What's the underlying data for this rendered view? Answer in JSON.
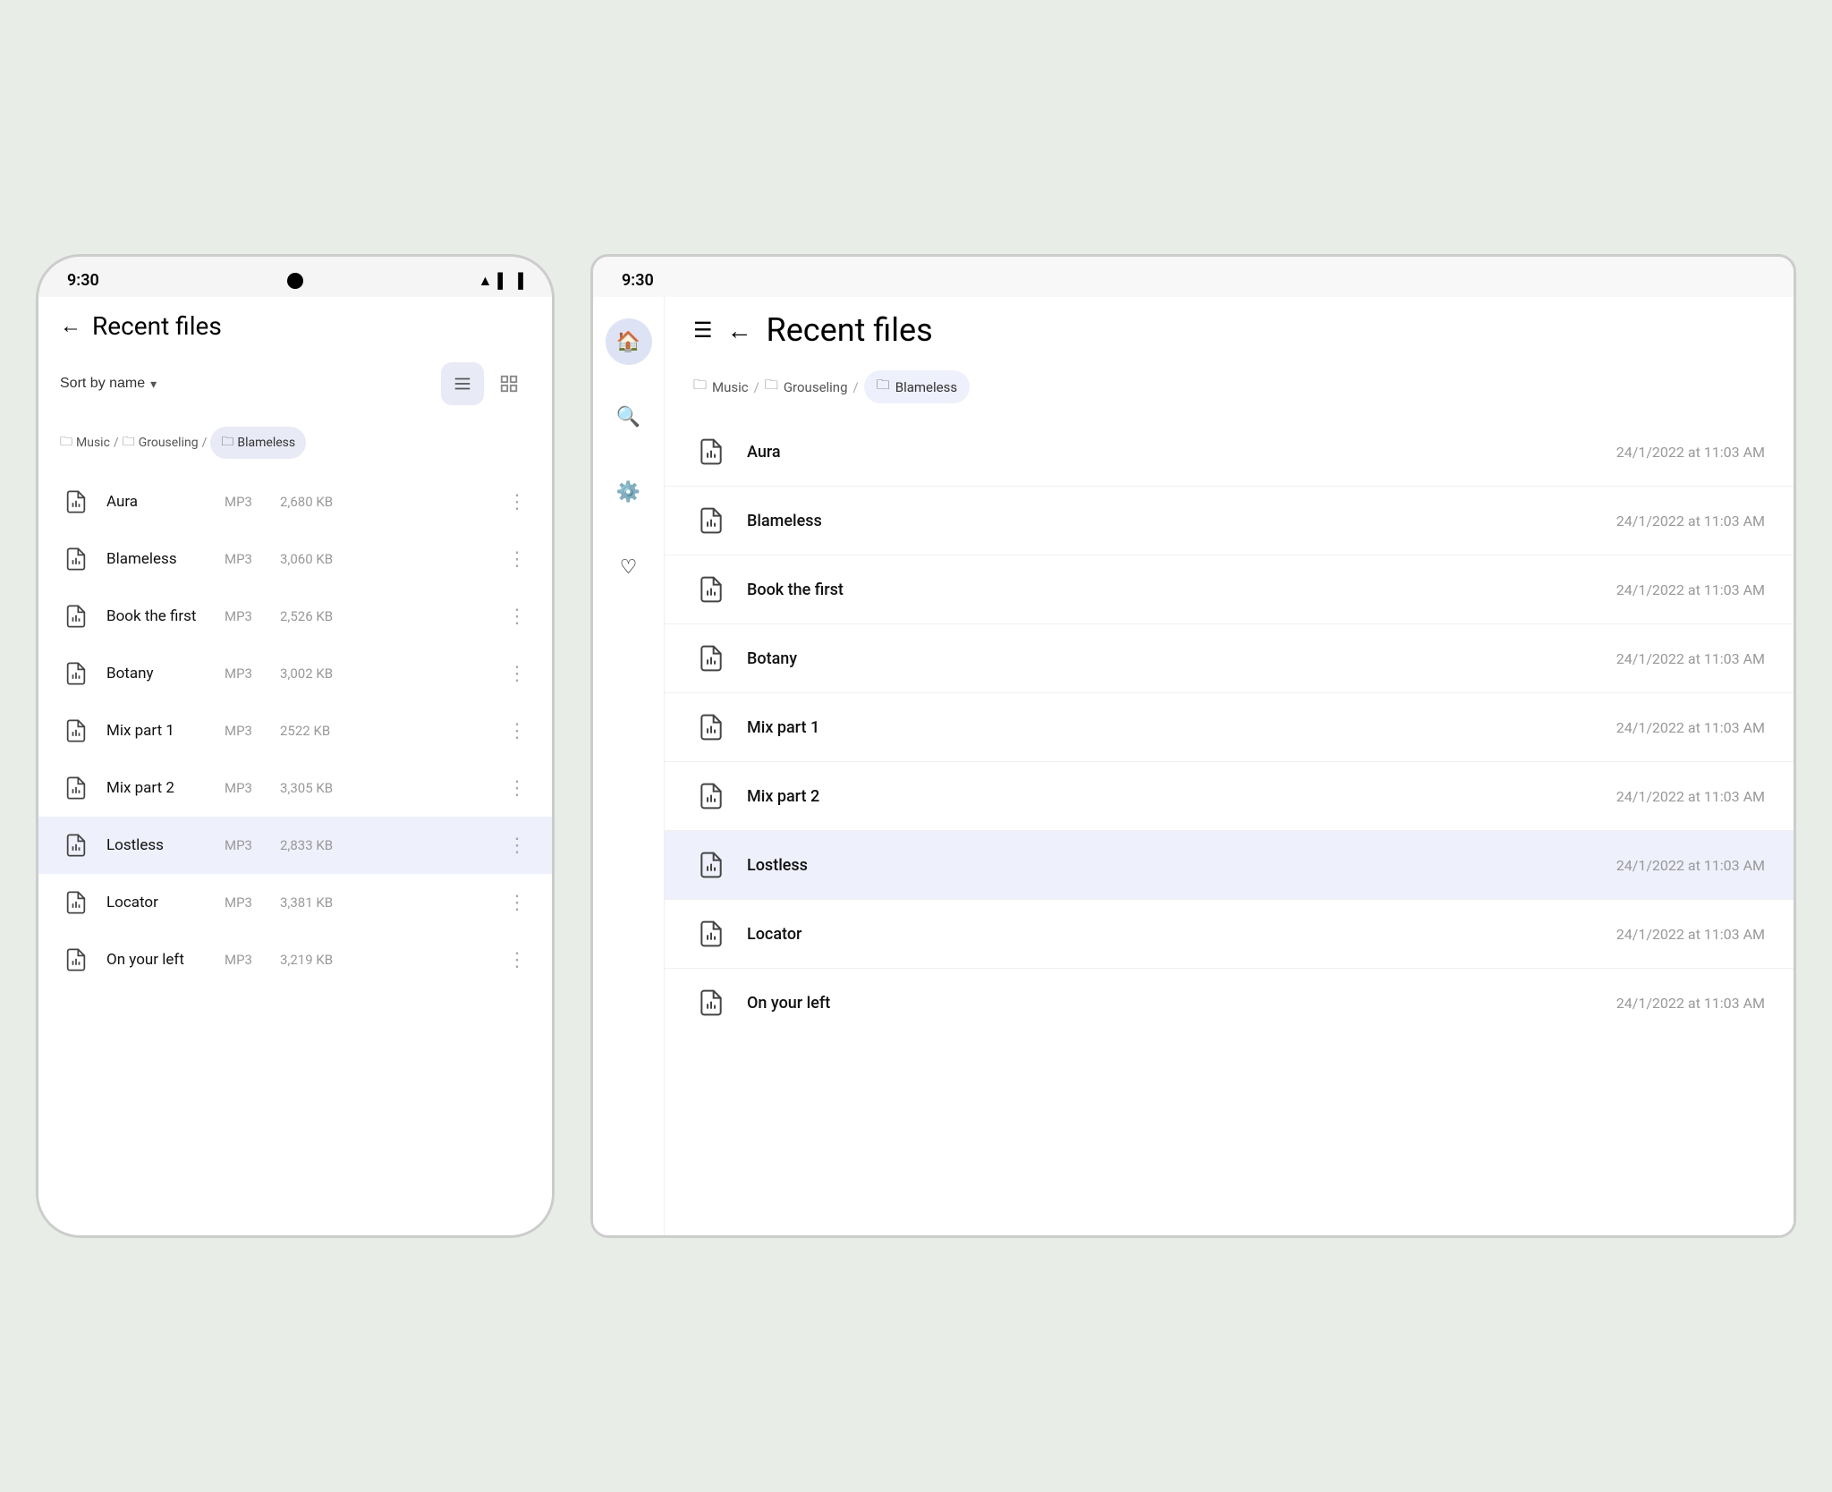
{
  "phone": {
    "status": {
      "time": "9:30"
    },
    "header": {
      "title": "Recent files",
      "back_label": "←"
    },
    "toolbar": {
      "sort_label": "Sort by name",
      "sort_arrow": "▾",
      "view_list_label": "list view",
      "view_grid_label": "grid view"
    },
    "breadcrumb": {
      "items": [
        {
          "label": "Music",
          "active": false
        },
        {
          "label": "Grouseling",
          "active": false
        },
        {
          "label": "Blameless",
          "active": true
        }
      ]
    },
    "files": [
      {
        "name": "Aura",
        "type": "MP3",
        "size": "2,680 KB",
        "selected": false
      },
      {
        "name": "Blameless",
        "type": "MP3",
        "size": "3,060 KB",
        "selected": false
      },
      {
        "name": "Book the first",
        "type": "MP3",
        "size": "2,526 KB",
        "selected": false
      },
      {
        "name": "Botany",
        "type": "MP3",
        "size": "3,002 KB",
        "selected": false
      },
      {
        "name": "Mix part 1",
        "type": "MP3",
        "size": "2522 KB",
        "selected": false
      },
      {
        "name": "Mix part 2",
        "type": "MP3",
        "size": "3,305 KB",
        "selected": false
      },
      {
        "name": "Lostless",
        "type": "MP3",
        "size": "2,833 KB",
        "selected": true
      },
      {
        "name": "Locator",
        "type": "MP3",
        "size": "3,381 KB",
        "selected": false
      },
      {
        "name": "On your left",
        "type": "MP3",
        "size": "3,219 KB",
        "selected": false
      }
    ]
  },
  "tablet": {
    "status": {
      "time": "9:30"
    },
    "header": {
      "title": "Recent files",
      "back_label": "←",
      "menu_label": "☰"
    },
    "breadcrumb": {
      "items": [
        {
          "label": "Music",
          "active": false
        },
        {
          "label": "Grouseling",
          "active": false
        },
        {
          "label": "Blameless",
          "active": true
        }
      ]
    },
    "sidebar": {
      "items": [
        {
          "icon": "🏠",
          "name": "home",
          "active": true
        },
        {
          "icon": "🔍",
          "name": "search",
          "active": false
        },
        {
          "icon": "⚙️",
          "name": "settings",
          "active": false
        },
        {
          "icon": "♡",
          "name": "favorites",
          "active": false
        }
      ]
    },
    "files": [
      {
        "name": "Aura",
        "date": "24/1/2022 at 11:03 AM",
        "selected": false
      },
      {
        "name": "Blameless",
        "date": "24/1/2022 at 11:03 AM",
        "selected": false
      },
      {
        "name": "Book the first",
        "date": "24/1/2022 at 11:03 AM",
        "selected": false
      },
      {
        "name": "Botany",
        "date": "24/1/2022 at 11:03 AM",
        "selected": false
      },
      {
        "name": "Mix part 1",
        "date": "24/1/2022 at 11:03 AM",
        "selected": false
      },
      {
        "name": "Mix part 2",
        "date": "24/1/2022 at 11:03 AM",
        "selected": false
      },
      {
        "name": "Lostless",
        "date": "24/1/2022 at 11:03 AM",
        "selected": true
      },
      {
        "name": "Locator",
        "date": "24/1/2022 at 11:03 AM",
        "selected": false
      },
      {
        "name": "On your left",
        "date": "24/1/2022 at 11:03 AM",
        "selected": false
      }
    ]
  }
}
